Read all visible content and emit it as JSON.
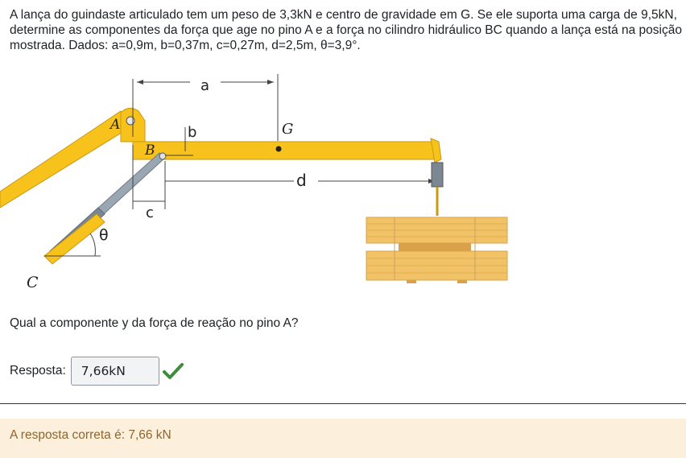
{
  "question": {
    "text": "A lança do guindaste articulado tem um peso de 3,3kN e centro de gravidade em G. Se ele suporta uma carga de 9,5kN, determine as componentes da força que age no pino A e a força no cilindro hidráulico BC quando a lança está na posição mostrada. Dados: a=0,9m, b=0,37m, c=0,27m, d=2,5m, θ=3,9°."
  },
  "figure": {
    "labels": {
      "a": "a",
      "b": "b",
      "c": "c",
      "d": "d",
      "G": "G",
      "A": "A",
      "B": "B",
      "C": "C",
      "theta": "θ"
    },
    "colors": {
      "boom": "#f6c21b",
      "boom_edge": "#c99a12",
      "wood": "#f2c366",
      "wood_dark": "#d9a24a",
      "steel": "#8c9aa6"
    }
  },
  "prompt": "Qual a componente y da força de reação no pino A?",
  "answer": {
    "label": "Resposta:",
    "value": "7,66kN",
    "status_icon": "check-icon",
    "status_color": "#3d8b3d"
  },
  "feedback": {
    "text": "A resposta correta é: 7,66 kN"
  }
}
